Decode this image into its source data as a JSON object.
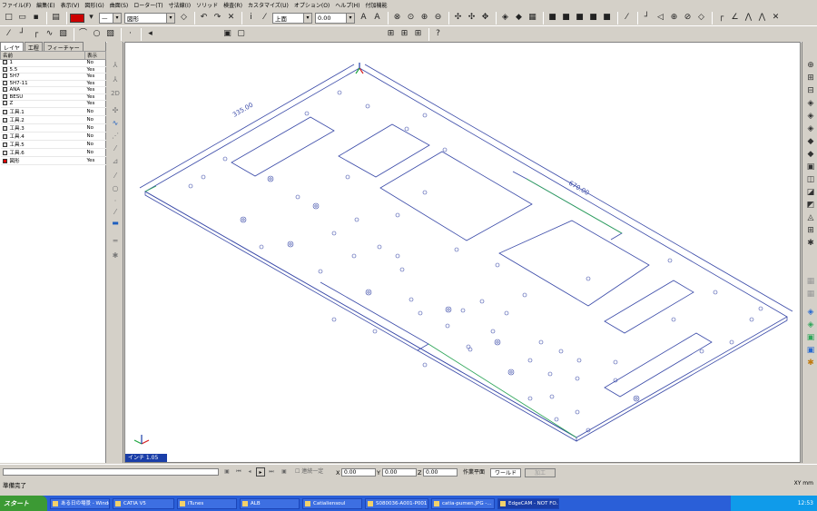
{
  "menu": [
    "ファイル(F)",
    "編集(E)",
    "表示(V)",
    "図形(G)",
    "曲面(S)",
    "ローター(T)",
    "寸法線(I)",
    "ソリッド",
    "検査(R)",
    "カスタマイズ(U)",
    "オプション(O)",
    "ヘルプ(H)",
    "付加機能"
  ],
  "toolbar1": {
    "shape_combo": "図形",
    "view_combo": "上面",
    "number_field": "0.00"
  },
  "layer_panel": {
    "tabs": [
      "レイヤ",
      "工程",
      "フィーチャー"
    ],
    "columns": [
      "名前",
      "表示"
    ],
    "rows": [
      {
        "name": "1",
        "visible": "No"
      },
      {
        "name": "5.5",
        "visible": "Yes"
      },
      {
        "name": "5H7",
        "visible": "Yes"
      },
      {
        "name": "5H7-11",
        "visible": "Yes"
      },
      {
        "name": "ANA",
        "visible": "Yes"
      },
      {
        "name": "BESU",
        "visible": "Yes"
      },
      {
        "name": "Z",
        "visible": "Yes"
      },
      {
        "name": "工具.1",
        "visible": "No"
      },
      {
        "name": "工具.2",
        "visible": "No"
      },
      {
        "name": "工具.3",
        "visible": "No"
      },
      {
        "name": "工具.4",
        "visible": "No"
      },
      {
        "name": "工具.5",
        "visible": "No"
      },
      {
        "name": "工具.6",
        "visible": "No"
      },
      {
        "name": "図形",
        "visible": "Yes"
      }
    ]
  },
  "canvas": {
    "dimension_left": "335.00",
    "dimension_right": "670.00",
    "unit_badge": "インチ 1.05"
  },
  "status": {
    "coord_x_label": "X",
    "coord_x": "0.00",
    "coord_y_label": "Y",
    "coord_y": "0.00",
    "coord_z_label": "Z",
    "coord_z": "0.00",
    "work_plane": "作業平面",
    "world": "ワールド",
    "finish": "加工",
    "continuous": "連続一定",
    "message": "準備完了",
    "units": "XY mm"
  },
  "taskbar": {
    "start": "スタート",
    "tasks": [
      "ある日の場景 - Windo...",
      "CATIA V5",
      "iTunes",
      "ALB",
      "Catialiensoul",
      "S080036-A001-P001",
      "catia-pumen.JPG -...",
      "EdgeCAM - NOT FO..."
    ],
    "active_index": 7,
    "clock": "12:53"
  }
}
